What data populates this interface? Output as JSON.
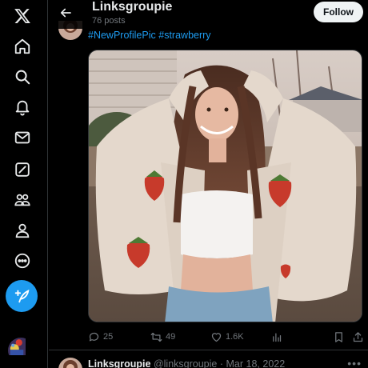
{
  "nav": {
    "items": [
      {
        "name": "x-logo-icon"
      },
      {
        "name": "home-icon"
      },
      {
        "name": "search-icon"
      },
      {
        "name": "notifications-icon"
      },
      {
        "name": "messages-icon"
      },
      {
        "name": "grok-icon"
      },
      {
        "name": "communities-icon"
      },
      {
        "name": "profile-icon"
      },
      {
        "name": "more-icon"
      }
    ],
    "compose_icon": "compose-post-icon"
  },
  "header": {
    "title": "Linksgroupie",
    "subtitle": "76 posts",
    "follow_label": "Follow"
  },
  "post": {
    "hashtag_1": "#NewProfilePic",
    "hashtag_2": "#strawberry",
    "actions": {
      "replies": "25",
      "reposts": "49",
      "likes": "1.6K"
    }
  },
  "next_post": {
    "name": "Linksgroupie",
    "handle": "@linksgroupie",
    "separator": "·",
    "date": "Mar 18, 2022"
  },
  "colors": {
    "accent": "#1d9bf0",
    "background": "#000000",
    "muted": "#71767b",
    "follow_bg": "#eff3f4"
  }
}
